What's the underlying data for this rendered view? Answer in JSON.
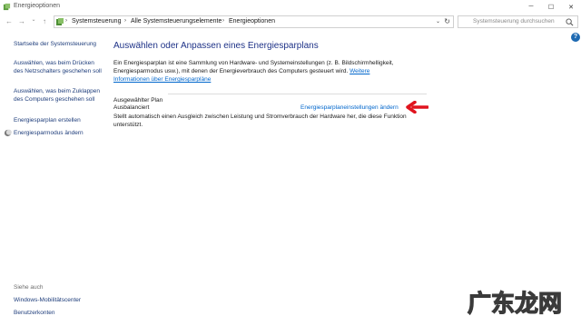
{
  "window": {
    "title": "Energieoptionen",
    "minimize": "─",
    "maximize": "☐",
    "close": "✕"
  },
  "nav": {
    "back": "←",
    "forward": "→",
    "recent": "⌄",
    "up": "↑",
    "breadcrumbs": [
      "Systemsteuerung",
      "Alle Systemsteuerungselemente",
      "Energieoptionen"
    ],
    "separator": "›",
    "dropdown": "⌄",
    "refresh": "↻",
    "search_placeholder": "Systemsteuerung durchsuchen"
  },
  "help": "?",
  "sidebar": {
    "home": "Startseite der Systemsteuerung",
    "items": [
      "Auswählen, was beim Drücken des Netzschalters geschehen soll",
      "Auswählen, was beim Zuklappen des Computers geschehen soll",
      "Energiesparplan erstellen",
      "Energiesparmodus ändern"
    ],
    "see_also": "Siehe auch",
    "see_also_items": [
      "Windows-Mobilitätscenter",
      "Benutzerkonten"
    ]
  },
  "main": {
    "title": "Auswählen oder Anpassen eines Energiesparplans",
    "intro_text": "Ein Energiesparplan ist eine Sammlung von Hardware- und Systemeinstellungen (z. B. Bildschirmhelligkeit, Energiesparmodus usw.), mit denen der Energieverbrauch des Computers gesteuert wird. ",
    "intro_link": "Weitere Informationen über Energiesparpläne",
    "section_label": "Ausgewählter Plan",
    "plan_name": "Ausbalanciert",
    "plan_link": "Energiesparplaneinstellungen ändern",
    "plan_desc": "Stellt automatisch einen Ausgleich zwischen Leistung und Stromverbrauch der Hardware her, die diese Funktion unterstützt."
  },
  "watermark": "广东龙网",
  "colors": {
    "link": "#0066cc",
    "title": "#1e3287",
    "arrow": "#e0141e"
  }
}
